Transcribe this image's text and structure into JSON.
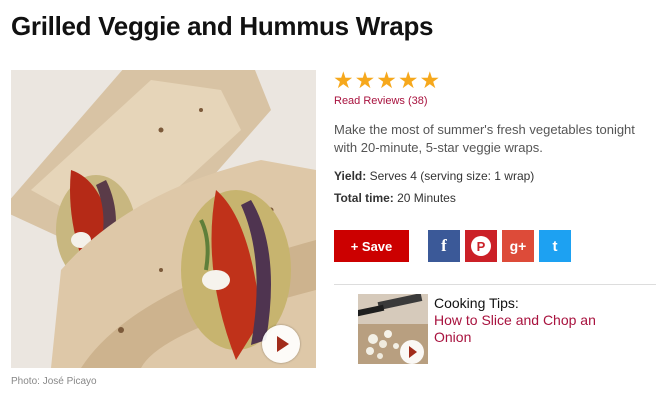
{
  "recipe": {
    "title": "Grilled Veggie and Hummus Wraps",
    "photo_credit": "Photo: José Picayo",
    "rating": {
      "stars": 5,
      "max": 5
    },
    "reviews_link": "Read Reviews (38)",
    "description": "Make the most of summer's fresh vegetables tonight with 20-minute, 5-star veggie wraps.",
    "yield_label": "Yield:",
    "yield_value": "Serves 4 (serving size: 1 wrap)",
    "total_time_label": "Total time:",
    "total_time_value": "20 Minutes"
  },
  "actions": {
    "save_label": "+ Save",
    "social": [
      {
        "name": "facebook",
        "glyph": "f",
        "color": "#3b5998"
      },
      {
        "name": "pinterest",
        "glyph": "P",
        "color": "#cb2027"
      },
      {
        "name": "google-plus",
        "glyph": "g+",
        "color": "#dd4b39"
      },
      {
        "name": "twitter",
        "glyph": "t",
        "color": "#1da1f2"
      }
    ]
  },
  "cooking_tips": {
    "heading": "Cooking Tips:",
    "link": "How to Slice and Chop an Onion"
  },
  "colors": {
    "accent": "#cc0000",
    "link": "#a8123e",
    "star": "#f6a81c"
  }
}
